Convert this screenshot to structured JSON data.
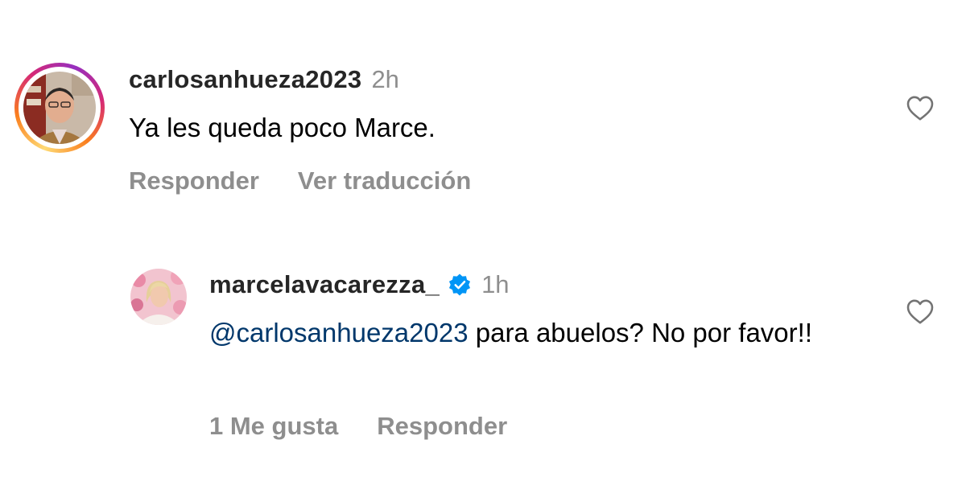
{
  "comments": [
    {
      "username": "carlosanhueza2023",
      "time": "2h",
      "text": "Ya les queda poco Marce.",
      "actions": [
        "Responder",
        "Ver traducción"
      ],
      "avatar": "profile-photo-older-man",
      "has_story_ring": true,
      "like_icon": "heart-outline-icon"
    },
    {
      "username": "marcelavacarezza_",
      "verified": true,
      "time": "1h",
      "mention": "@carlosanhueza2023",
      "text": "para abuelos? No por favor!!",
      "actions": [
        "1 Me gusta",
        "Responder"
      ],
      "avatar": "profile-photo-blonde-woman",
      "like_icon": "heart-outline-icon"
    }
  ],
  "colors": {
    "username": "#262626",
    "secondary_text": "#8e8e8e",
    "mention": "#00376b",
    "verified_badge": "#0095f6"
  }
}
